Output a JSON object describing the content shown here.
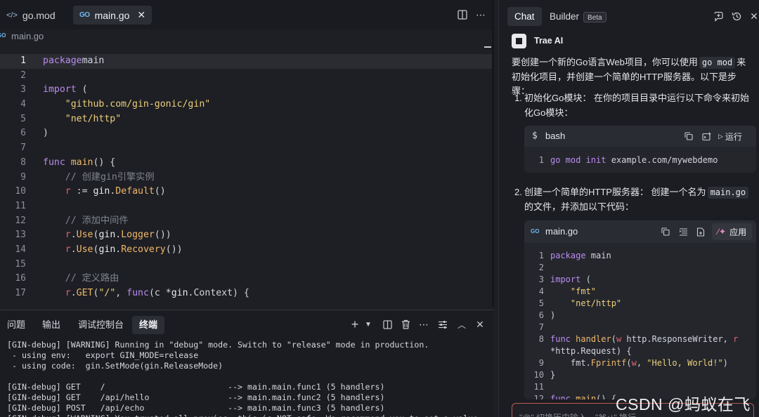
{
  "editor": {
    "tabs": [
      {
        "label": "go.mod",
        "icon": "code-icon"
      },
      {
        "label": "main.go",
        "icon": "go-file-icon",
        "active": true
      }
    ],
    "breadcrumb": "main.go",
    "current_line": 1,
    "lines": [
      {
        "n": "1",
        "t": [
          [
            "kw",
            "package"
          ],
          [
            "",
            "main"
          ]
        ]
      },
      {
        "n": "2",
        "t": []
      },
      {
        "n": "3",
        "t": [
          [
            "kw",
            "import"
          ],
          [
            "",
            " ("
          ]
        ]
      },
      {
        "n": "4",
        "t": [
          [
            "",
            "    "
          ],
          [
            "st",
            "\"github.com/gin-gonic/gin\""
          ]
        ]
      },
      {
        "n": "5",
        "t": [
          [
            "",
            "    "
          ],
          [
            "st",
            "\"net/http\""
          ]
        ]
      },
      {
        "n": "6",
        "t": [
          [
            "",
            ")"
          ]
        ]
      },
      {
        "n": "7",
        "t": []
      },
      {
        "n": "8",
        "t": [
          [
            "kw",
            "func"
          ],
          [
            "",
            " "
          ],
          [
            "fn",
            "main"
          ],
          [
            "",
            "() {"
          ]
        ]
      },
      {
        "n": "9",
        "t": [
          [
            "",
            "    "
          ],
          [
            "cm",
            "// 创建gin引擎实例"
          ]
        ]
      },
      {
        "n": "10",
        "t": [
          [
            "",
            "    "
          ],
          [
            "va",
            "r"
          ],
          [
            "",
            " := "
          ],
          [
            "ty",
            "gin"
          ],
          [
            "",
            "."
          ],
          [
            "fn",
            "Default"
          ],
          [
            "",
            "()"
          ]
        ]
      },
      {
        "n": "11",
        "t": []
      },
      {
        "n": "12",
        "t": [
          [
            "",
            "    "
          ],
          [
            "cm",
            "// 添加中间件"
          ]
        ]
      },
      {
        "n": "13",
        "t": [
          [
            "",
            "    "
          ],
          [
            "va",
            "r"
          ],
          [
            "",
            "."
          ],
          [
            "fn",
            "Use"
          ],
          [
            "",
            "("
          ],
          [
            "ty",
            "gin"
          ],
          [
            "",
            "."
          ],
          [
            "fn",
            "Logger"
          ],
          [
            "",
            "())"
          ]
        ]
      },
      {
        "n": "14",
        "t": [
          [
            "",
            "    "
          ],
          [
            "va",
            "r"
          ],
          [
            "",
            "."
          ],
          [
            "fn",
            "Use"
          ],
          [
            "",
            "("
          ],
          [
            "ty",
            "gin"
          ],
          [
            "",
            "."
          ],
          [
            "fn",
            "Recovery"
          ],
          [
            "",
            "())"
          ]
        ]
      },
      {
        "n": "15",
        "t": []
      },
      {
        "n": "16",
        "t": [
          [
            "",
            "    "
          ],
          [
            "cm",
            "// 定义路由"
          ]
        ]
      },
      {
        "n": "17",
        "t": [
          [
            "",
            "    "
          ],
          [
            "va",
            "r"
          ],
          [
            "",
            "."
          ],
          [
            "fn",
            "GET"
          ],
          [
            "",
            "("
          ],
          [
            "st",
            "\"/\""
          ],
          [
            "",
            ", "
          ],
          [
            "kw",
            "func"
          ],
          [
            "",
            "(c *"
          ],
          [
            "ty",
            "gin"
          ],
          [
            "",
            ".Context) {"
          ]
        ]
      }
    ]
  },
  "panel": {
    "tabs": [
      {
        "label": "问题"
      },
      {
        "label": "输出"
      },
      {
        "label": "调试控制台"
      },
      {
        "label": "终端",
        "active": true
      }
    ],
    "terminal_lines": [
      "[GIN-debug] [WARNING] Running in \"debug\" mode. Switch to \"release\" mode in production.",
      " - using env:   export GIN_MODE=release",
      " - using code:  gin.SetMode(gin.ReleaseMode)",
      "",
      "[GIN-debug] GET    /                         --> main.main.func1 (5 handlers)",
      "[GIN-debug] GET    /api/hello                --> main.main.func2 (5 handlers)",
      "[GIN-debug] POST   /api/echo                 --> main.main.func3 (5 handlers)",
      "[GIN-debug] [WARNING] You trusted all proxies, this is NOT safe. We recommend you to set a value."
    ]
  },
  "chat": {
    "tabs": {
      "chat": "Chat",
      "builder": "Builder",
      "beta": "Beta"
    },
    "assistant_name": "Trae AI",
    "intro": {
      "before": "要创建一个新的Go语言Web项目，你可以使用",
      "code": "go mod",
      "after": "来初始化项目，并创建一个简单的HTTP服务器。以下是步骤："
    },
    "step1": {
      "num": "1.",
      "text": "初始化Go模块：  在你的项目目录中运行以下命令来初始化Go模块："
    },
    "bash_block": {
      "lang": "bash",
      "run_label": "运行",
      "lines": [
        {
          "n": "1",
          "t": [
            [
              "kw",
              "go mod init "
            ],
            [
              "",
              "example.com/mywebdemo"
            ]
          ]
        }
      ]
    },
    "step2": {
      "num": "2.",
      "before": "创建一个简单的HTTP服务器：  创建一个名为",
      "code": "main.go",
      "after": "的文件，并添加以下代码："
    },
    "go_block": {
      "filename": "main.go",
      "apply_label": "应用",
      "lines": [
        {
          "n": "1",
          "t": [
            [
              "kw",
              "package"
            ],
            [
              "",
              " main"
            ]
          ]
        },
        {
          "n": "2",
          "t": []
        },
        {
          "n": "3",
          "t": [
            [
              "kw",
              "import"
            ],
            [
              "",
              " ("
            ]
          ]
        },
        {
          "n": "4",
          "t": [
            [
              "",
              "    "
            ],
            [
              "st",
              "\"fmt\""
            ]
          ]
        },
        {
          "n": "5",
          "t": [
            [
              "",
              "    "
            ],
            [
              "st",
              "\"net/http\""
            ]
          ]
        },
        {
          "n": "6",
          "t": [
            [
              "",
              ")"
            ]
          ]
        },
        {
          "n": "7",
          "t": []
        },
        {
          "n": "8",
          "t": [
            [
              "kw",
              "func"
            ],
            [
              "",
              " "
            ],
            [
              "fn",
              "handler"
            ],
            [
              "",
              "("
            ],
            [
              "va",
              "w"
            ],
            [
              "",
              " http.ResponseWriter, "
            ],
            [
              "va",
              "r"
            ]
          ]
        },
        {
          "n": "",
          "t": [
            [
              "",
              "*http.Request) {"
            ]
          ]
        },
        {
          "n": "9",
          "t": [
            [
              "",
              "    fmt."
            ],
            [
              "fn",
              "Fprintf"
            ],
            [
              "",
              "("
            ],
            [
              "va",
              "w"
            ],
            [
              "",
              ", "
            ],
            [
              "st",
              "\"Hello, World!\""
            ],
            [
              "",
              ")"
            ]
          ]
        },
        {
          "n": "10",
          "t": [
            [
              "",
              "}"
            ]
          ]
        },
        {
          "n": "11",
          "t": []
        },
        {
          "n": "12",
          "t": [
            [
              "kw",
              "func"
            ],
            [
              "",
              " "
            ],
            [
              "fn",
              "main"
            ],
            [
              "",
              "() {"
            ]
          ]
        }
      ]
    },
    "input_placeholder": "\"@\" 切换历史输入，\"⌘↵\" 换行"
  },
  "watermark": "CSDN @蚂蚁在飞"
}
